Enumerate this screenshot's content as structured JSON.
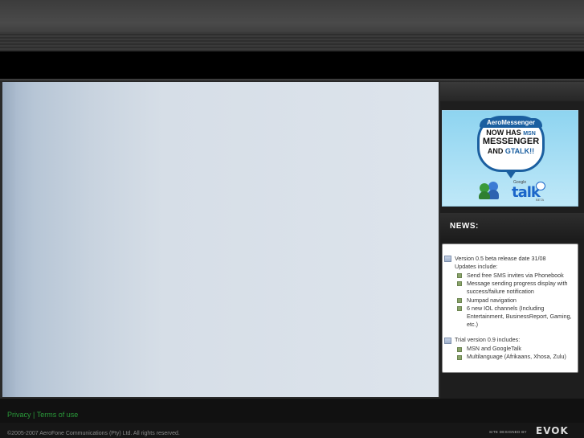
{
  "promo": {
    "brand": "AeroMessenger",
    "line1_prefix": "NOW HAS",
    "line1_msn": "MSN",
    "line2": "MESSENGER",
    "line3_prefix": "AND",
    "line3_gtalk": "GTALK!!",
    "gtalk_small": "Google",
    "gtalk_word": "talk",
    "gtalk_beta": "BETA"
  },
  "news": {
    "title": "NEWS:",
    "sections": [
      {
        "heading_lines": [
          "Version 0.5 beta release date 31/08",
          "Updates include:"
        ],
        "items": [
          [
            "Send free SMS invites via Phonebook"
          ],
          [
            "Message sending progress display with",
            "success/failure notification"
          ],
          [
            "Numpad navigation"
          ],
          [
            "6 new IOL channels (Including",
            "Entertainment, BusinessReport, Gaming,",
            "etc.)"
          ]
        ]
      },
      {
        "heading_lines": [
          "Trial version 0.9 includes:"
        ],
        "items": [
          [
            "MSN and GoogleTalk"
          ],
          [
            "Multilanguage (Afrikaans, Xhosa, Zulu)"
          ]
        ]
      }
    ]
  },
  "footer": {
    "privacy": "Privacy",
    "separator": "|",
    "terms": "Terms of use",
    "copyright": "©2005-2007 AeroFone Communications (Pty) Ltd. All rights reserved.",
    "designed_by": "SITE DESIGNED BY",
    "designer_logo": "EVOK"
  },
  "colors": {
    "link_green": "#2a9a3a",
    "main_panel": "#dde4ec",
    "background": "#1a1a1a"
  }
}
